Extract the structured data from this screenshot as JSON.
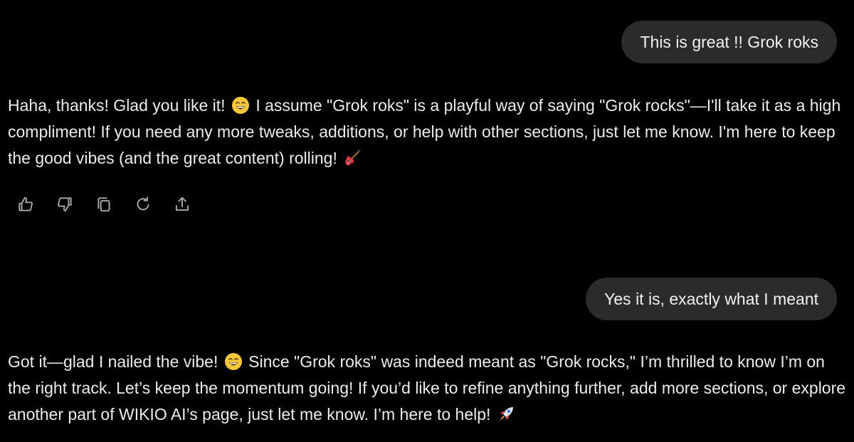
{
  "conversation": {
    "user_message_1": "This is great !! Grok roks",
    "assistant_message_1": {
      "part_1": "Haha, thanks! Glad you like it! ",
      "emoji_1": "grinning-face-emoji",
      "part_2": " I assume \"Grok roks\" is a playful way of saying \"Grok rocks\"—I'll take it as a high compliment! If you need any more tweaks, additions, or help with other sections, just let me know. I'm here to keep the good vibes (and the great content) rolling! ",
      "emoji_2": "guitar-emoji"
    },
    "actions": [
      {
        "name": "thumbs-up-icon"
      },
      {
        "name": "thumbs-down-icon"
      },
      {
        "name": "copy-icon"
      },
      {
        "name": "regenerate-icon"
      },
      {
        "name": "share-icon"
      }
    ],
    "user_message_2": "Yes it is, exactly what I meant",
    "assistant_message_2": {
      "part_1": "Got it—glad I nailed the vibe! ",
      "emoji_1": "grinning-face-emoji",
      "part_2": " Since \"Grok roks\" was indeed meant as \"Grok rocks,\" I’m thrilled to know I’m on the right track. Let’s keep the momentum going! If you’d like to refine anything further, add more sections, or explore another part of WIKIO AI’s page, just let me know. I’m here to help! ",
      "emoji_2": "rocket-emoji"
    }
  },
  "colors": {
    "background": "#000000",
    "user_bubble": "#2b2b2e",
    "text": "#ececec",
    "icon": "#a8a8a8"
  }
}
